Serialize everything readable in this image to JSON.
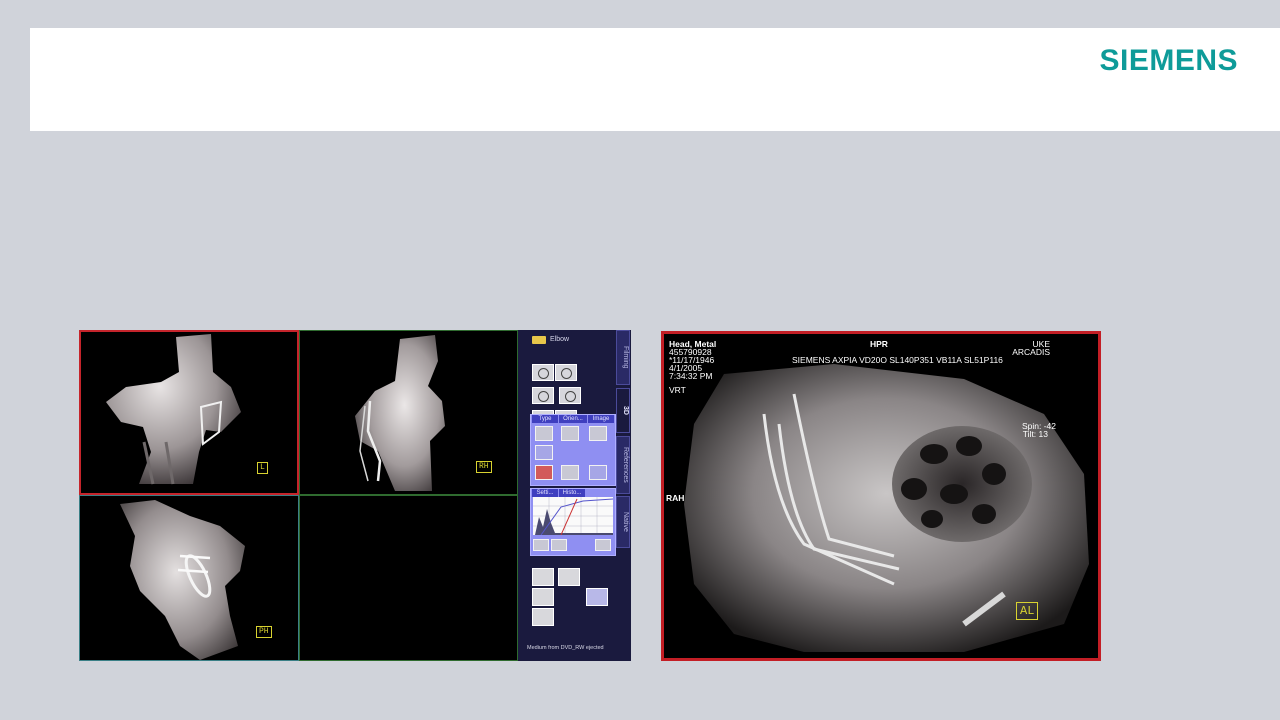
{
  "header": {
    "logo": "SIEMENS"
  },
  "viewer": {
    "orientation_labels": [
      "L",
      "RH",
      "PH"
    ],
    "panel": {
      "folder_label": "Elbow",
      "side_tabs": [
        "Filming",
        "3D",
        "References",
        "Native"
      ],
      "type_tabs": [
        "Type",
        "Orien...",
        "Image"
      ],
      "chart_tabs": [
        "Setti...",
        "Histo..."
      ],
      "status": "Medium from DVD_RW ejected"
    }
  },
  "hpr": {
    "name": "Head, Metal",
    "id": "455790928",
    "dob": "*11/17/1946",
    "date": "4/1/2005",
    "time": "7:34:32 PM",
    "render": "VRT",
    "center_title": "HPR",
    "device_info": "SIEMENS AXPIA VD20O SL140P351 VB11A SL51P116",
    "institution": "UKE",
    "system": "ARCADIS",
    "spin": "Spin: -42",
    "tilt": "Tilt: 13",
    "side": "RAH",
    "orient": "AL"
  },
  "colors": {
    "accent": "#0e9b99",
    "frame_red": "#c31e25",
    "panel_blue": "#8f8ff2"
  }
}
